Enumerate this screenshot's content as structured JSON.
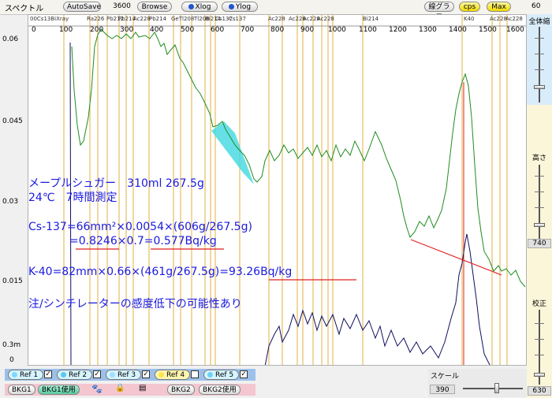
{
  "toolbar": {
    "title": "スペクトル",
    "autosave": "AutoSave",
    "time": "3600",
    "browse": "Browse",
    "xlog": "Xlog",
    "ylog": "Ylog",
    "line_graph": "線グラフ",
    "cps": "cps",
    "max": "Max",
    "zoom_value": "60"
  },
  "plot": {
    "y_ticks": [
      "0.06",
      "0.045",
      "0.03",
      "0.015",
      "0.3m",
      "0"
    ],
    "x_ticks": [
      "0",
      "100",
      "200",
      "300",
      "400",
      "500",
      "600",
      "700",
      "800",
      "900",
      "1000",
      "1100",
      "1200",
      "1300",
      "1400",
      "1500",
      "1600"
    ],
    "peaks": [
      "00Cs13BiXray",
      "Ra226",
      "Pb212",
      "Pb214",
      "Ac228",
      "Pb214",
      "GeTl208",
      "Tl208",
      "Bi214",
      "Cs137",
      "Cs137",
      "Ac228",
      "Ac228",
      "Ac228",
      "Ac228",
      "Bi214",
      "K40",
      "Ac228",
      "Ac228"
    ],
    "annotation": {
      "line1": "メープルシュガー　310ml 267.5g",
      "line2": "24℃　7時間測定",
      "line3": "Cs-137=66mm²×0.0054×(606g/267.5g)",
      "line4_a": "=",
      "line4_b": "0.8246",
      "line4_c": "×0.7=",
      "line4_d": "0.577Bq/kg",
      "line5_a": "K-40=82mm×0.66×(461g/267.5g)=",
      "line5_b": "93.26Bq/kg",
      "line6": "注/シンチレーターの感度低下の可能性あり"
    }
  },
  "right_panel": {
    "zoom_label": "全体縮",
    "height_label": "高さ",
    "height_value": "740",
    "calib_label": "校正",
    "calib_value": "630"
  },
  "bottom": {
    "refs": [
      {
        "label": "Ref 1",
        "checked": "✓",
        "color": "#7fd8ff"
      },
      {
        "label": "Ref 2",
        "checked": "✓",
        "color": "#5bc8f0"
      },
      {
        "label": "Ref 3",
        "checked": "✓",
        "color": "#9fe0ff"
      },
      {
        "label": "Ref 4",
        "checked": "",
        "color": "#ffe34d"
      },
      {
        "label": "Ref 5",
        "checked": "✓",
        "color": "#6fd0f8"
      }
    ],
    "bkg1": "BKG1",
    "bkg1_use": "BKG1使用",
    "bkg2": "BKG2",
    "bkg2_use": "BKG2使用",
    "scale_label": "スケール",
    "scale_value": "390"
  },
  "colors": {
    "spectrum": "#1f8c1f",
    "background_spectrum": "#101060",
    "peak_line": "#e0b040",
    "baseline": "#e02020",
    "annotation": "#1a1ae0",
    "cs_area": "#40d8e0"
  }
}
